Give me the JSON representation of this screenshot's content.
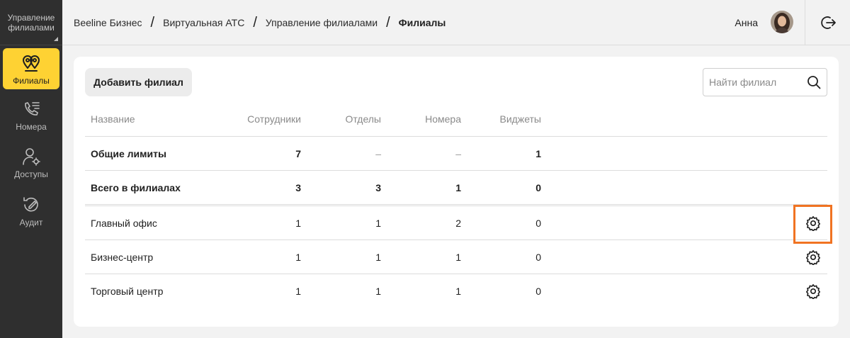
{
  "sidebar": {
    "header": "Управление филиалами",
    "items": [
      {
        "label": "Филиалы",
        "icon": "branches-pin-icon",
        "active": true
      },
      {
        "label": "Номера",
        "icon": "phone-list-icon",
        "active": false
      },
      {
        "label": "Доступы",
        "icon": "user-gear-icon",
        "active": false
      },
      {
        "label": "Аудит",
        "icon": "audit-icon",
        "active": false
      }
    ]
  },
  "header": {
    "breadcrumbs": [
      "Beeline Бизнес",
      "Виртуальная АТС",
      "Управление филиалами",
      "Филиалы"
    ],
    "separator": "/",
    "user_name": "Анна"
  },
  "toolbar": {
    "add_button": "Добавить филиал",
    "search_placeholder": "Найти филиал"
  },
  "table": {
    "columns": [
      "Название",
      "Сотрудники",
      "Отделы",
      "Номера",
      "Виджеты"
    ],
    "summary_rows": [
      {
        "name": "Общие лимиты",
        "employees": "7",
        "departments": "–",
        "numbers": "–",
        "widgets": "1"
      },
      {
        "name": "Всего в филиалах",
        "employees": "3",
        "departments": "3",
        "numbers": "1",
        "widgets": "0"
      }
    ],
    "rows": [
      {
        "name": "Главный офис",
        "employees": "1",
        "departments": "1",
        "numbers": "2",
        "widgets": "0"
      },
      {
        "name": "Бизнес-центр",
        "employees": "1",
        "departments": "1",
        "numbers": "1",
        "widgets": "0"
      },
      {
        "name": "Торговый центр",
        "employees": "1",
        "departments": "1",
        "numbers": "1",
        "widgets": "0"
      }
    ]
  },
  "colors": {
    "accent": "#fed233",
    "sidebar_bg": "#2f2f2f",
    "highlight": "#f07322"
  }
}
